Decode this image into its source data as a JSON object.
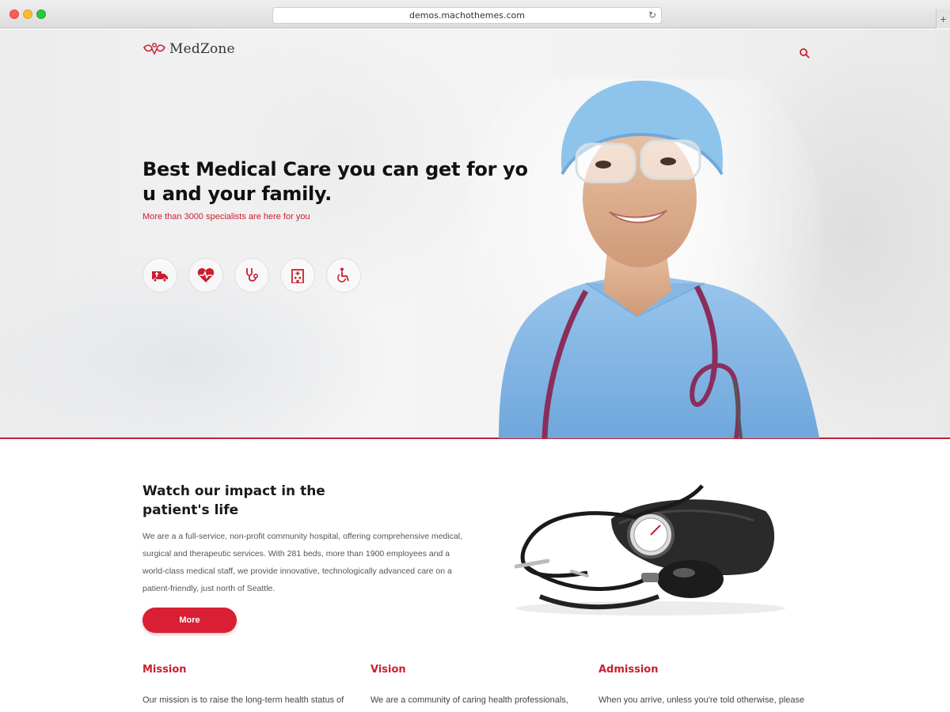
{
  "browser": {
    "url": "demos.machothemes.com",
    "new_tab_label": "+"
  },
  "header": {
    "logo_text": "MedZone"
  },
  "hero": {
    "title": "Best Medical Care you can get for you and your family.",
    "subtitle": "More than 3000 specialists are here for you",
    "icons": [
      "ambulance-icon",
      "heartbeat-icon",
      "stethoscope-icon",
      "hospital-icon",
      "wheelchair-icon"
    ]
  },
  "impact": {
    "title": "Watch our impact in the patient's life",
    "text": "We are a a full-service, non-profit community hospital, offering comprehensive medical, surgical and therapeutic services. With 281 beds, more than 1900 employees and a world-class medical staff, we provide innovative, technologically advanced care on a patient-friendly, just north of Seattle.",
    "button_label": "More"
  },
  "columns": [
    {
      "title": "Mission",
      "text": "Our mission is to raise the long-term health status of"
    },
    {
      "title": "Vision",
      "text": "We are a community of caring health professionals,"
    },
    {
      "title": "Admission",
      "text": "When you arrive, unless you're told otherwise, please"
    }
  ],
  "colors": {
    "accent": "#c8202f",
    "button": "#d81f34",
    "scrubs": "#8fbde6"
  }
}
